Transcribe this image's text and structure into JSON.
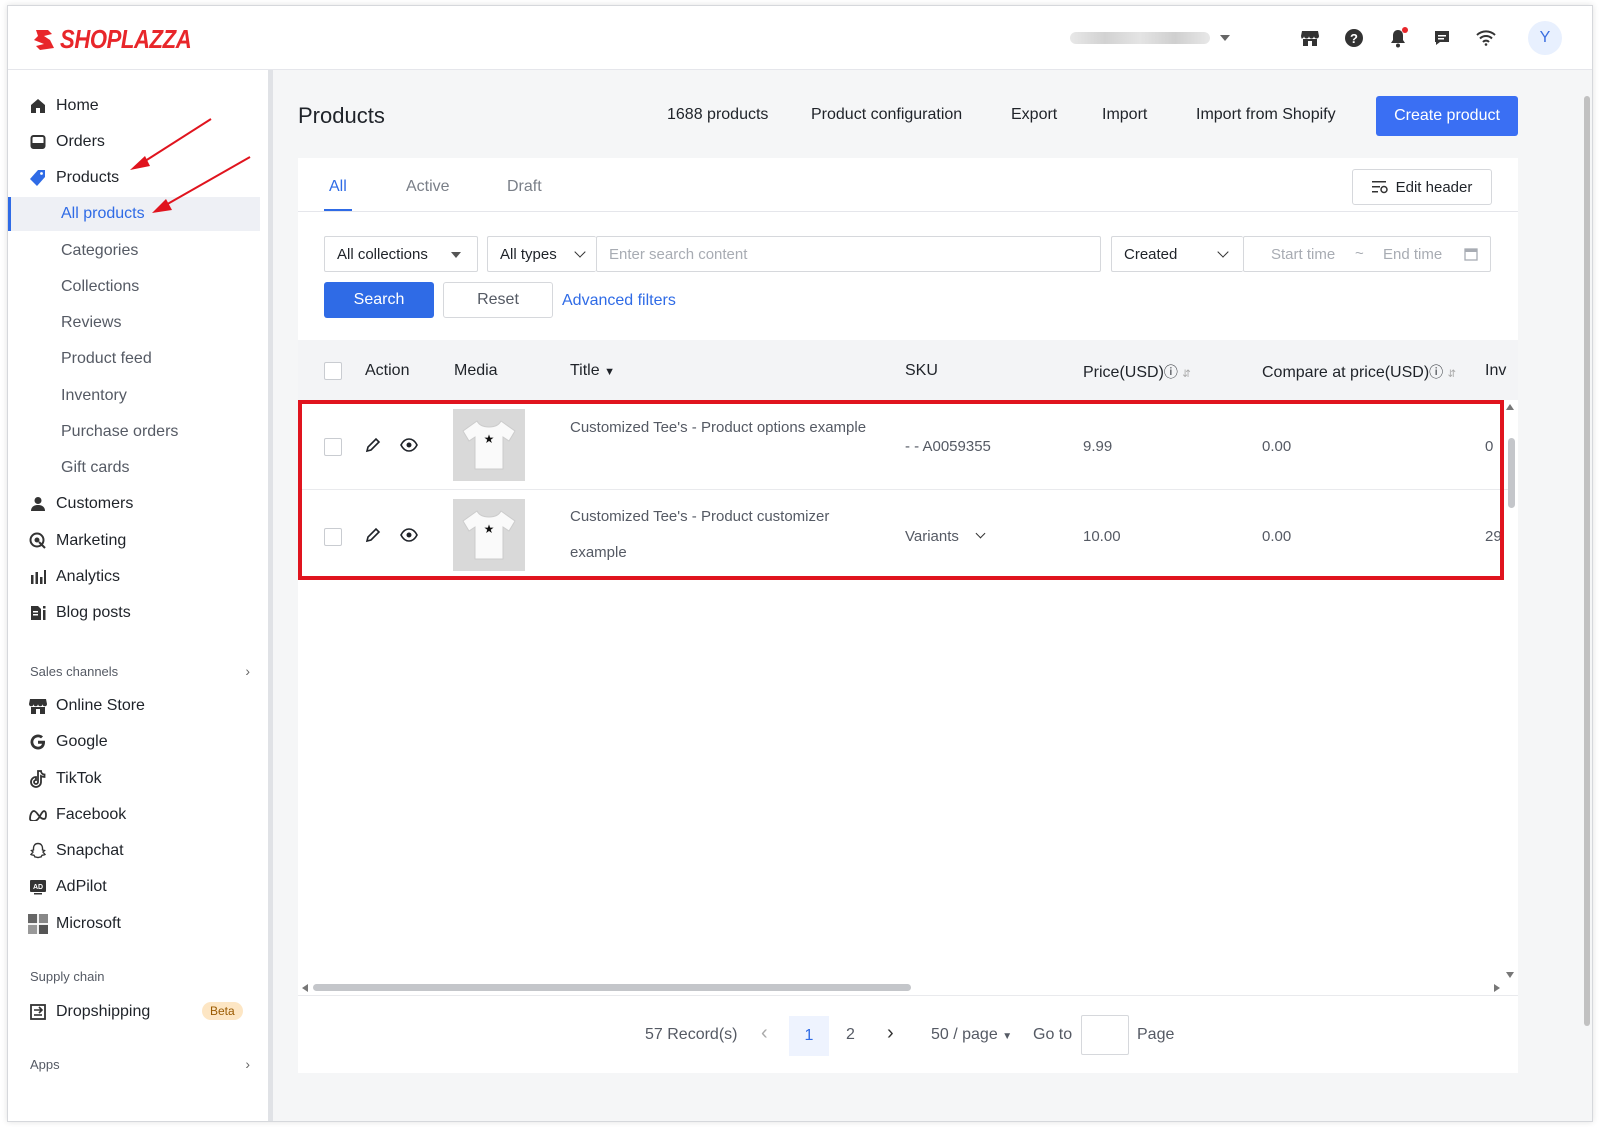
{
  "app": {
    "brand": "SHOPLAZZA",
    "accent_color": "#2f6be6",
    "brand_color": "#e8262a",
    "avatar_letter": "Y"
  },
  "topbar": {
    "icons": [
      "storefront-icon",
      "help-icon",
      "bell-icon",
      "message-icon",
      "wifi-icon"
    ]
  },
  "sidebar": {
    "main": [
      {
        "label": "Home",
        "icon": "home-icon"
      },
      {
        "label": "Orders",
        "icon": "orders-icon"
      },
      {
        "label": "Products",
        "icon": "tag-icon"
      }
    ],
    "products_sub": [
      "All products",
      "Categories",
      "Collections",
      "Reviews",
      "Product feed",
      "Inventory",
      "Purchase orders",
      "Gift cards"
    ],
    "more": [
      {
        "label": "Customers",
        "icon": "person-icon"
      },
      {
        "label": "Marketing",
        "icon": "marketing-icon"
      },
      {
        "label": "Analytics",
        "icon": "analytics-icon"
      },
      {
        "label": "Blog posts",
        "icon": "blog-icon"
      }
    ],
    "sales_channels_title": "Sales channels",
    "sales_channels": [
      {
        "label": "Online Store",
        "icon": "store-icon"
      },
      {
        "label": "Google",
        "icon": "google-icon"
      },
      {
        "label": "TikTok",
        "icon": "tiktok-icon"
      },
      {
        "label": "Facebook",
        "icon": "meta-icon"
      },
      {
        "label": "Snapchat",
        "icon": "snapchat-icon"
      },
      {
        "label": "AdPilot",
        "icon": "adpilot-icon"
      },
      {
        "label": "Microsoft",
        "icon": "microsoft-icon"
      }
    ],
    "supply_chain_title": "Supply chain",
    "dropshipping": "Dropshipping",
    "beta": "Beta",
    "apps_title": "Apps"
  },
  "header": {
    "title": "Products",
    "count": "1688 products",
    "product_configuration": "Product configuration",
    "export": "Export",
    "import": "Import",
    "import_shopify": "Import from Shopify",
    "create": "Create product"
  },
  "tabs": [
    "All",
    "Active",
    "Draft"
  ],
  "edit_header": "Edit header",
  "filters": {
    "collections": "All collections",
    "types": "All types",
    "search_placeholder": "Enter search content",
    "created": "Created",
    "start_time": "Start time",
    "tilde": "~",
    "end_time": "End time",
    "search_btn": "Search",
    "reset_btn": "Reset",
    "advanced": "Advanced filters"
  },
  "table": {
    "columns": {
      "action": "Action",
      "media": "Media",
      "title": "Title",
      "sku": "SKU",
      "price": "Price(USD)",
      "compare": "Compare at price(USD)",
      "inventory": "Inver"
    },
    "rows": [
      {
        "title": "Customized Tee's - Product options example",
        "sku": "- - A0059355",
        "price": "9.99",
        "compare": "0.00",
        "inventory": "0"
      },
      {
        "title": "Customized Tee's - Product customizer example",
        "sku": "Variants",
        "price": "10.00",
        "compare": "0.00",
        "inventory": "29"
      }
    ]
  },
  "pagination": {
    "records": "57 Record(s)",
    "page1": "1",
    "page2": "2",
    "per_page": "50 / page",
    "goto": "Go to",
    "page": "Page"
  }
}
